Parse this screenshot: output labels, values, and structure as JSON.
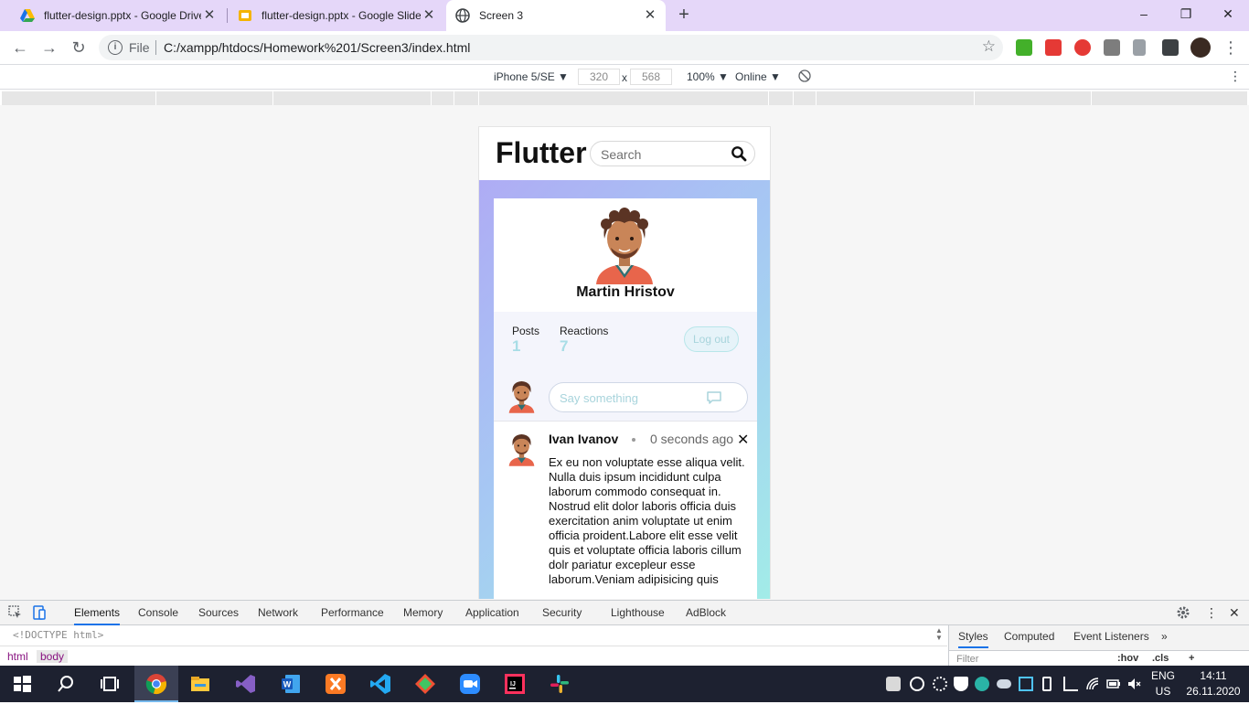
{
  "browser": {
    "tabs": [
      {
        "title": "flutter-design.pptx - Google Drive",
        "icon": "google-drive-icon"
      },
      {
        "title": "flutter-design.pptx - Google Slides",
        "icon": "google-slides-icon"
      },
      {
        "title": "Screen 3",
        "icon": "globe-icon",
        "active": true
      }
    ],
    "new_tab": "+",
    "window_controls": {
      "minimize": "–",
      "maximize": "❐",
      "close": "✕"
    },
    "address": {
      "scheme_label": "File",
      "url": "C:/xampp/htdocs/Homework%201/Screen3/index.html"
    }
  },
  "device_toolbar": {
    "device": "iPhone 5/SE ▼",
    "width": "320",
    "times": "x",
    "height": "568",
    "zoom": "100% ▼",
    "network": "Online ▼"
  },
  "app": {
    "logo": "Flutter",
    "search_placeholder": "Search",
    "profile": {
      "name": "Martin Hristov"
    },
    "stats": {
      "posts_label": "Posts",
      "posts_value": "1",
      "reactions_label": "Reactions",
      "reactions_value": "7"
    },
    "logout_label": "Log out",
    "compose_placeholder": "Say something",
    "post": {
      "author": "Ivan Ivanov",
      "time": "0 seconds ago",
      "close": "✕",
      "body": "Ex eu non voluptate esse aliqua velit. Nulla duis ipsum incididunt culpa laborum commodo consequat in. Nostrud elit dolor laboris officia duis exercitation anim voluptate ut enim officia proident.Labore elit esse velit quis et voluptate officia laboris cillum dolr pariatur excepleur esse laborum.Veniam adipisicing quis"
    }
  },
  "devtools": {
    "tabs": [
      "Elements",
      "Console",
      "Sources",
      "Network",
      "Performance",
      "Memory",
      "Application",
      "Security",
      "Lighthouse",
      "AdBlock"
    ],
    "active_tab": "Elements",
    "doctype": "<!DOCTYPE html>",
    "breadcrumbs": [
      "html",
      "body"
    ],
    "side_tabs": [
      "Styles",
      "Computed",
      "Event Listeners",
      "»"
    ],
    "filter_placeholder": "Filter",
    "filter_hov": ":hov",
    "filter_cls": ".cls",
    "filter_plus": "+"
  },
  "taskbar": {
    "apps": [
      "windows-start-icon",
      "search-icon",
      "task-view-icon",
      "chrome-icon",
      "file-explorer-icon",
      "visual-studio-icon",
      "word-icon",
      "xampp-icon",
      "vscode-icon",
      "git-icon",
      "zoom-icon",
      "intellij-icon",
      "slack-icon"
    ],
    "language": {
      "line1": "ENG",
      "line2": "US"
    },
    "clock": {
      "time": "14:11",
      "date": "26.11.2020 г."
    }
  },
  "colors": {
    "tabstrip": "#e5d7f9",
    "accent": "#1a73e8",
    "stat_value": "#a8dde6",
    "taskbar": "#1d2130"
  }
}
